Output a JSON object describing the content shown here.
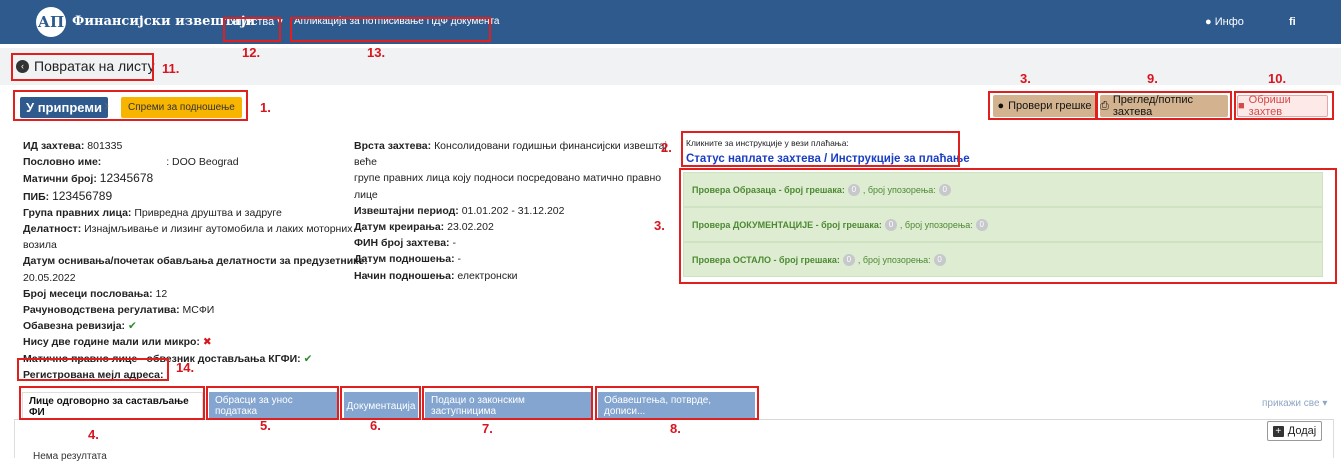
{
  "navbar": {
    "logo": "АП",
    "brand": "Финансијски извештаји",
    "instructions": "Упутства ▾",
    "pdf_app": "Апликација за потписивање ПДФ документа",
    "info": "Инфо",
    "user_initials": "fi"
  },
  "back": {
    "label": "Повратак на листу"
  },
  "status": {
    "current": "У припреми",
    "ready": "Спреми за подношење"
  },
  "actions": {
    "check_errors": "Провери грешке",
    "preview": "Преглед/потпис захтева",
    "delete": "Обриши захтев"
  },
  "info": {
    "request_id_label": "ИД захтева:",
    "request_id": "801335",
    "business_name_label": "Пословно име:",
    "business_name": ": DOO Beograd",
    "reg_no_label": "Матични број:",
    "reg_no": "12345678",
    "pib_label": "ПИБ:",
    "pib": "123456789",
    "group_label": "Група правних лица:",
    "group": "Привредна друштва и задруге",
    "activity_label": "Делатност:",
    "activity_1": "Изнајмљивање и лизинг аутомобила и лаких моторних",
    "activity_2": "возила",
    "founding_label": "Датум оснивања/почетак обављања делатности за предузетнике:",
    "founding": "20.05.2022",
    "months_label": "Број месеци пословања:",
    "months": "12",
    "regulation_label": "Рачуноводствена регулатива:",
    "regulation": "МСФИ",
    "audit_label": "Обавезна ревизија:",
    "small_label": "Нису две године мали или микро:",
    "kgfi_label": "Матично правно лице - обвезник достављања КГФИ:",
    "email_label": "Регистрована мејл адреса:"
  },
  "mid": {
    "type_label": "Врста захтева:",
    "type_1": "Консолидовани годишњи финансијски извештај веће",
    "type_2": "групе правних лица коју подноси посредовано матично правно лице",
    "period_label": "Извештајни период:",
    "period": "01.01.202 - 31.12.202",
    "created_label": "Датум креирања:",
    "created": "23.02.202",
    "fin_label": "ФИН број захтева:",
    "fin": "-",
    "submitted_label": "Датум подношења:",
    "submitted": "-",
    "method_label": "Начин подношења:",
    "method": "електронски"
  },
  "payment": {
    "hint": "Кликните за инструкције у вези плаћања:",
    "link": "Статус наплате захтева / Инструкције за плаћање"
  },
  "checks": [
    {
      "label": "Провера Образаца - број грешака:",
      "errors": "0",
      "warn_label": ", број упозорења:",
      "warnings": "0"
    },
    {
      "label": "Провера ДОКУМЕНТАЦИЈЕ - број грешака:",
      "errors": "0",
      "warn_label": ", број упозорења:",
      "warnings": "0"
    },
    {
      "label": "Провера ОСТАЛО - број грешака:",
      "errors": "0",
      "warn_label": ", број упозорења:",
      "warnings": "0"
    }
  ],
  "tabs": [
    "Лице одговорно за састављање ФИ",
    "Обрасци за унос података",
    "Документација",
    "Подаци о законским заступницима",
    "Обавештења, потврде, дописи..."
  ],
  "show_all": "прикажи све ▾",
  "add": "Додај",
  "no_results": "Нема резултата",
  "annotations": [
    "1.",
    "2.",
    "3.",
    "3.",
    "4.",
    "5.",
    "6.",
    "7.",
    "8.",
    "9.",
    "10.",
    "11.",
    "12.",
    "13.",
    "14."
  ],
  "colors": {
    "navbar": "#2e5a8e",
    "annotation": "#e0201f",
    "check_bg": "#deecd2"
  }
}
